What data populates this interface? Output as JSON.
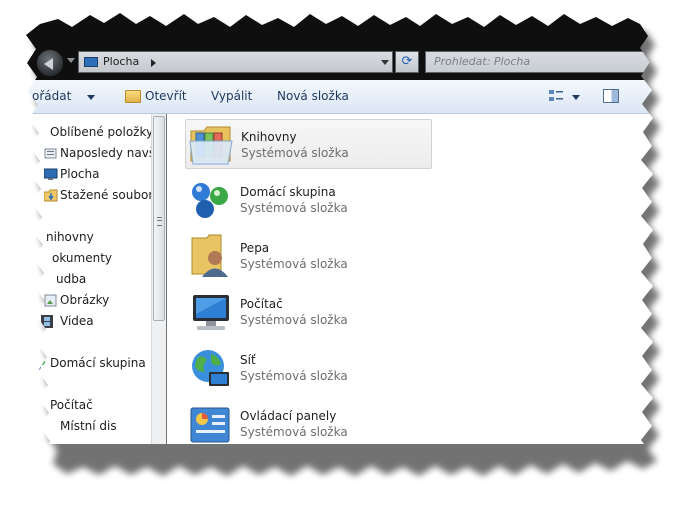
{
  "window": {
    "address": {
      "location": "Plocha",
      "icon": "desktop-icon"
    },
    "search": {
      "placeholder": "Prohledat: Plocha"
    },
    "refresh_icon": "refresh-icon"
  },
  "toolbar": {
    "organize_label": "ořádat",
    "open_label": "Otevřít",
    "burn_label": "Vypálit",
    "new_folder_label": "Nová složka"
  },
  "sidebar": {
    "items": [
      {
        "label": "Oblíbené položky",
        "icon": "favorites-star-icon"
      },
      {
        "label": "Naposledy navští",
        "icon": "recent-places-icon"
      },
      {
        "label": "Plocha",
        "icon": "desktop-icon"
      },
      {
        "label": "Stažené soubory",
        "icon": "downloads-folder-icon"
      },
      {
        "label": "nihovny",
        "icon": "libraries-icon"
      },
      {
        "label": "okumenty",
        "icon": "documents-icon"
      },
      {
        "label": "udba",
        "icon": "music-icon"
      },
      {
        "label": "Obrázky",
        "icon": "pictures-icon"
      },
      {
        "label": "Videa",
        "icon": "videos-icon"
      },
      {
        "label": "Domácí skupina",
        "icon": "homegroup-icon"
      },
      {
        "label": "Počítač",
        "icon": "computer-icon"
      },
      {
        "label": "Místní dis",
        "icon": "local-disk-icon"
      }
    ]
  },
  "content": {
    "items": [
      {
        "name": "Knihovny",
        "type": "Systémová složka",
        "icon": "libraries-folder-icon",
        "selected": true
      },
      {
        "name": "Domácí skupina",
        "type": "Systémová složka",
        "icon": "homegroup-icon"
      },
      {
        "name": "Pepa",
        "type": "Systémová složka",
        "icon": "user-folder-icon"
      },
      {
        "name": "Počítač",
        "type": "Systémová složka",
        "icon": "computer-icon"
      },
      {
        "name": "Síť",
        "type": "Systémová složka",
        "icon": "network-globe-icon"
      },
      {
        "name": "Ovládací panely",
        "type": "Systémová složka",
        "icon": "control-panel-icon"
      }
    ]
  }
}
